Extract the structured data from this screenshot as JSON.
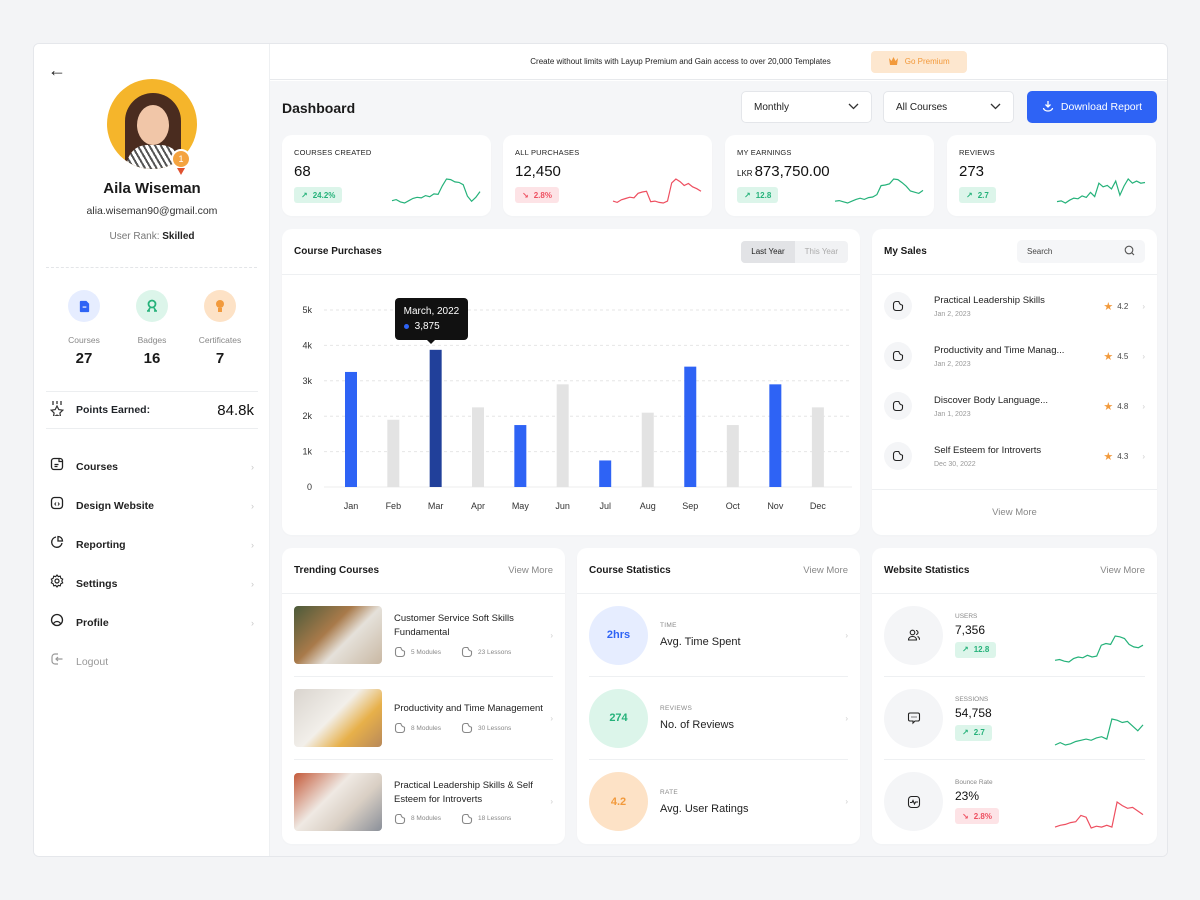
{
  "banner": {
    "text": "Create without limits with Layup Premium and Gain access to over 20,000 Templates",
    "premium_label": "Go Premium"
  },
  "profile": {
    "name": "Aila Wiseman",
    "email": "alia.wiseman90@gmail.com",
    "rank_label": "User Rank:",
    "rank_value": "Skilled",
    "medal_number": "1",
    "stats": [
      {
        "label": "Courses",
        "value": "27",
        "icon": "document-icon",
        "color": "#2e63f5",
        "bg": "#e6edff"
      },
      {
        "label": "Badges",
        "value": "16",
        "icon": "badge-icon",
        "color": "#25b27a",
        "bg": "#dcf5ea"
      },
      {
        "label": "Certificates",
        "value": "7",
        "icon": "certificate-icon",
        "color": "#f29a3c",
        "bg": "#fde2c6"
      }
    ],
    "points_label": "Points Earned:",
    "points_value": "84.8k"
  },
  "nav": [
    {
      "label": "Courses",
      "icon": "courses-icon"
    },
    {
      "label": "Design Website",
      "icon": "design-website-icon"
    },
    {
      "label": "Reporting",
      "icon": "pie-chart-icon"
    },
    {
      "label": "Settings",
      "icon": "gear-icon"
    },
    {
      "label": "Profile",
      "icon": "profile-icon"
    },
    {
      "label": "Logout",
      "icon": "logout-icon"
    }
  ],
  "header": {
    "title": "Dashboard",
    "period_select": "Monthly",
    "course_select": "All Courses",
    "download_label": "Download Report"
  },
  "kpis": [
    {
      "label": "COURSES CREATED",
      "prefix": "",
      "value": "68",
      "change": "24.2%",
      "trend": "up",
      "spark": [
        3,
        3.2,
        2.8,
        2.6,
        3,
        3.4,
        3.6,
        3.5,
        3.9,
        3.7,
        4.2,
        4.1,
        5.6,
        6.8,
        6.7,
        6.3,
        6.2,
        5.8,
        3.8,
        2.9,
        3.6,
        4.6
      ]
    },
    {
      "label": "ALL PURCHASES",
      "prefix": "",
      "value": "12,450",
      "change": "2.8%",
      "trend": "down",
      "spark": [
        3,
        2.8,
        3.2,
        3.4,
        3.6,
        3.5,
        4.2,
        4.4,
        4.5,
        2.9,
        3,
        2.8,
        2.7,
        3,
        5.8,
        6.4,
        6,
        5.4,
        5.7,
        5.2,
        4.9,
        4.5
      ]
    },
    {
      "label": "MY EARNINGS",
      "prefix": "LKR",
      "value": "873,750.00",
      "change": "12.8",
      "trend": "up",
      "spark": [
        3,
        3.1,
        2.9,
        2.7,
        3,
        3.3,
        3.5,
        3.3,
        3.6,
        3.7,
        4.1,
        5.6,
        5.7,
        5.9,
        6.7,
        6.6,
        6.1,
        5.5,
        4.7,
        4.5,
        4.3,
        4.8
      ]
    },
    {
      "label": "REVIEWS",
      "prefix": "",
      "value": "273",
      "change": "2.7",
      "trend": "up",
      "spark": [
        3,
        3.1,
        2.8,
        3.2,
        3.5,
        3.4,
        3.8,
        3.6,
        4.3,
        3.7,
        5.6,
        5.1,
        5.3,
        4.8,
        5.9,
        3.9,
        5.2,
        6.2,
        5.6,
        5.9,
        5.6,
        5.7
      ]
    }
  ],
  "course_purchases": {
    "title": "Course Purchases",
    "toggle": {
      "active": "Last Year",
      "inactive": "This Year"
    },
    "tooltip": {
      "title": "March, 2022",
      "value": "3,875"
    }
  },
  "chart_data": {
    "type": "bar",
    "title": "Course Purchases",
    "xlabel": "",
    "ylabel": "",
    "categories": [
      "Jan",
      "Feb",
      "Mar",
      "Apr",
      "May",
      "Jun",
      "Jul",
      "Aug",
      "Sep",
      "Oct",
      "Nov",
      "Dec"
    ],
    "values": [
      3250,
      1900,
      3875,
      2250,
      1750,
      2900,
      750,
      2100,
      3400,
      1750,
      2900,
      2250
    ],
    "highlight": [
      true,
      false,
      true,
      false,
      true,
      false,
      true,
      false,
      true,
      false,
      true,
      false
    ],
    "selected_index": 2,
    "colors": {
      "highlight": "#2e63f5",
      "selected": "#21409a",
      "muted": "#e3e3e3"
    },
    "ylim": [
      0,
      5000
    ],
    "yticks": [
      0,
      1000,
      2000,
      3000,
      4000,
      5000
    ],
    "ytick_labels": [
      "0",
      "1k",
      "2k",
      "3k",
      "4k",
      "5k"
    ],
    "grid": true
  },
  "my_sales": {
    "title": "My Sales",
    "search_placeholder": "Search",
    "items": [
      {
        "title": "Practical Leadership Skills",
        "date": "Jan 2, 2023",
        "rating": "4.2"
      },
      {
        "title": "Productivity and Time Manag...",
        "date": "Jan 2, 2023",
        "rating": "4.5"
      },
      {
        "title": "Discover Body Language...",
        "date": "Jan 1, 2023",
        "rating": "4.8"
      },
      {
        "title": "Self Esteem for Introverts",
        "date": "Dec 30, 2022",
        "rating": "4.3"
      }
    ],
    "view_more": "View More"
  },
  "trending": {
    "title": "Trending Courses",
    "view_more": "View More",
    "items": [
      {
        "title": "Customer Service Soft Skills Fundamental",
        "modules": "5 Modules",
        "lessons": "23 Lessons"
      },
      {
        "title": "Productivity and Time Management",
        "modules": "8 Modules",
        "lessons": "30 Lessons"
      },
      {
        "title": "Practical Leadership Skills & Self Esteem for Introverts",
        "modules": "8 Modules",
        "lessons": "18 Lessons"
      }
    ]
  },
  "course_stats": {
    "title": "Course Statistics",
    "view_more": "View More",
    "items": [
      {
        "value": "2hrs",
        "caption": "TIME",
        "name": "Avg. Time Spent",
        "color": "#2e63f5",
        "bg": "#e6edff"
      },
      {
        "value": "274",
        "caption": "REVIEWS",
        "name": "No. of Reviews",
        "color": "#25b27a",
        "bg": "#dcf5ea"
      },
      {
        "value": "4.2",
        "caption": "RATE",
        "name": "Avg. User Ratings",
        "color": "#f29a3c",
        "bg": "#fde2c6"
      }
    ]
  },
  "website_stats": {
    "title": "Website Statistics",
    "view_more": "View More",
    "items": [
      {
        "caption": "USERS",
        "value": "7,356",
        "change": "12.8",
        "trend": "up",
        "icon": "users-icon",
        "spark": [
          3,
          3.1,
          2.9,
          2.8,
          3.2,
          3.4,
          3.3,
          3.6,
          3.4,
          3.5,
          4.8,
          5,
          4.9,
          5.9,
          5.8,
          5.6,
          4.9,
          4.6,
          4.5,
          4.8
        ]
      },
      {
        "caption": "SESSIONS",
        "value": "54,758",
        "change": "2.7",
        "trend": "up",
        "icon": "chat-icon",
        "spark": [
          3,
          3.2,
          3,
          3.1,
          3.3,
          3.4,
          3.5,
          3.4,
          3.6,
          3.7,
          3.5,
          5.2,
          5.1,
          4.9,
          5,
          4.6,
          4.2,
          4.7
        ]
      },
      {
        "caption": "Bounce Rate",
        "value": "23%",
        "change": "2.8%",
        "trend": "down",
        "icon": "activity-icon",
        "spark": [
          3,
          3.2,
          3.3,
          3.5,
          3.6,
          4.3,
          4.1,
          2.9,
          3.1,
          3,
          3.2,
          3,
          5.8,
          5.4,
          5.1,
          5.2,
          4.8,
          4.4
        ]
      }
    ]
  }
}
